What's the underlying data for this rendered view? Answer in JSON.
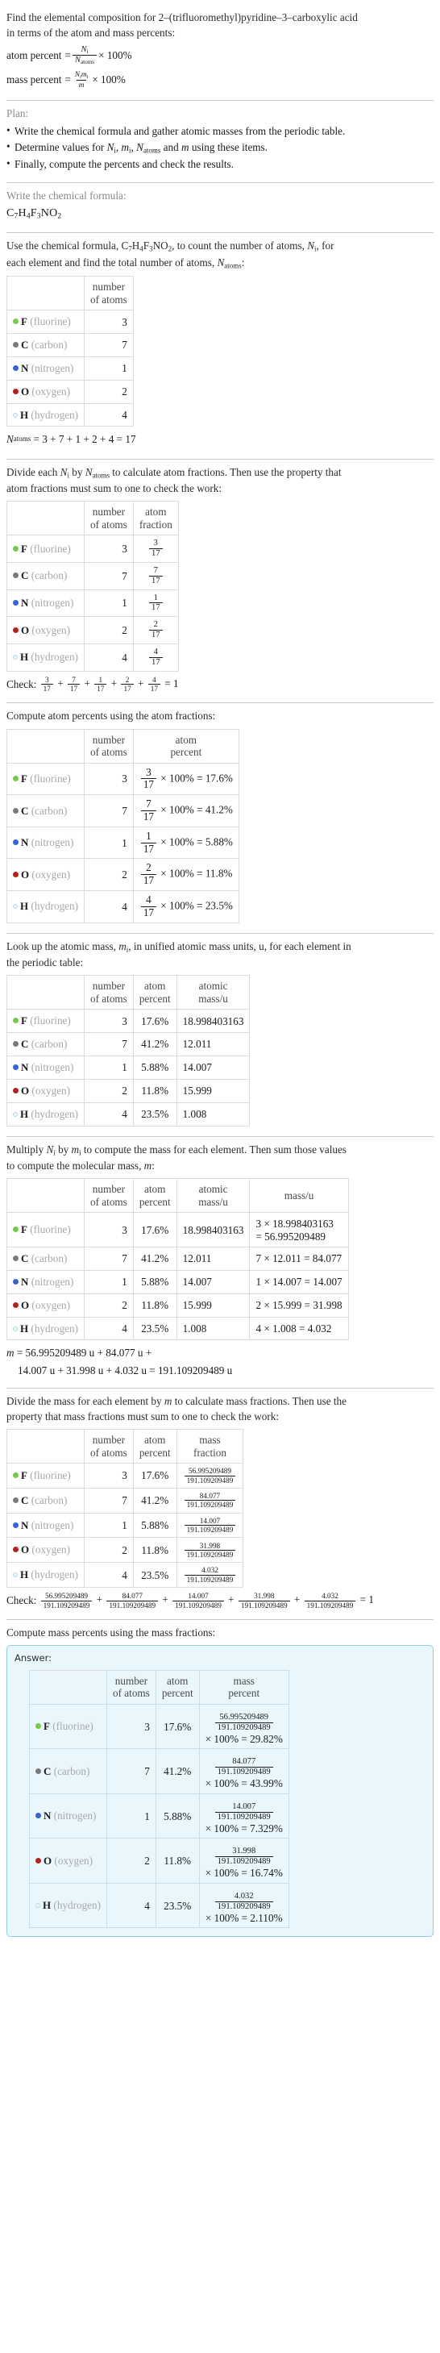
{
  "colors": {
    "fluorine": "#78c850",
    "carbon": "#7a7a7a",
    "nitrogen": "#3a63cf",
    "oxygen": "#b22222",
    "hydrogen_fill": "#ecf7fb",
    "hydrogen_stroke": "#b6d7e0",
    "answer_bg": "#e9f7fd",
    "answer_border": "#8fcfe6",
    "rule": "#c9c9c9",
    "table_border": "#dcdcdc"
  },
  "intro": {
    "line1": "Find the elemental composition for 2–(trifluoromethyl)pyridine–3–carboxylic acid",
    "line2": "in terms of the atom and mass percents:",
    "atom_percent_label": "atom percent",
    "mass_percent_label": "mass percent",
    "equals": "=",
    "times100": "× 100%",
    "Ni": "N",
    "Ni_sub": "i",
    "Natoms": "N",
    "Natoms_sub": "atoms",
    "mi": "m",
    "mi_sub": "i",
    "m": "m"
  },
  "plan": {
    "title": "Plan:",
    "items": [
      "Write the chemical formula and gather atomic masses from the periodic table.",
      "Determine values for Ni, mi, Natoms and m using these items.",
      "Finally, compute the percents and check the results."
    ],
    "item2_parts": {
      "before": "Determine values for ",
      "mid1": ", ",
      "mid2": ", ",
      "mid3": " and ",
      "after": " using these items."
    }
  },
  "formula_section": {
    "prompt": "Write the chemical formula:",
    "formula_parts": [
      {
        "sym": "C",
        "sub": "7"
      },
      {
        "sym": "H",
        "sub": "4"
      },
      {
        "sym": "F",
        "sub": "3"
      },
      {
        "sym": "N",
        "sub": ""
      },
      {
        "sym": "O",
        "sub": "2"
      }
    ],
    "formula_plain": "C7H4F3NO2"
  },
  "count_section": {
    "prompt_a": "Use the chemical formula, ",
    "prompt_b": ", to count the number of atoms, ",
    "prompt_c": ", for",
    "prompt_d": "each element and find the total number of atoms, ",
    "prompt_e": ":",
    "headers": [
      "",
      "number of atoms"
    ],
    "total_line": "= 3 + 7 + 1 + 2 + 4 = 17"
  },
  "fraction_section": {
    "prompt_a": "Divide each ",
    "prompt_b": " by ",
    "prompt_c": " to calculate atom fractions. Then use the property that",
    "prompt_d": "atom fractions must sum to one to check the work:",
    "headers": [
      "",
      "number of atoms",
      "atom fraction"
    ],
    "check_label": "Check:",
    "check_result": "= 1"
  },
  "atompercent_section": {
    "prompt": "Compute atom percents using the atom fractions:",
    "headers": [
      "",
      "number of atoms",
      "atom percent"
    ]
  },
  "atomicmass_section": {
    "prompt_a": "Look up the atomic mass, ",
    "prompt_b": ", in unified atomic mass units, u, for each element in",
    "prompt_c": "the periodic table:",
    "headers": [
      "",
      "number of atoms",
      "atom percent",
      "atomic mass/u"
    ]
  },
  "masscalc_section": {
    "prompt_a": "Multiply ",
    "prompt_b": " by ",
    "prompt_c": " to compute the mass for each element. Then sum those values",
    "prompt_d": "to compute the molecular mass, ",
    "prompt_e": ":",
    "headers": [
      "",
      "number of atoms",
      "atom percent",
      "atomic mass/u",
      "mass/u"
    ],
    "molar_line1": "= 56.995209489 u + 84.077 u +",
    "molar_line2": "14.007 u + 31.998 u + 4.032 u = 191.109209489 u"
  },
  "massfraction_section": {
    "prompt_a": "Divide the mass for each element by ",
    "prompt_b": " to calculate mass fractions. Then use the",
    "prompt_c": "property that mass fractions must sum to one to check the work:",
    "headers": [
      "",
      "number of atoms",
      "atom percent",
      "mass fraction"
    ],
    "check_label": "Check:",
    "check_result": "= 1"
  },
  "masspercent_section": {
    "prompt": "Compute mass percents using the mass fractions:",
    "answer_label": "Answer:",
    "headers": [
      "",
      "number of atoms",
      "atom percent",
      "mass percent"
    ],
    "times100": "× 100%"
  },
  "total_atoms": "17",
  "molecular_mass": "191.109209489",
  "elements": [
    {
      "symbol": "F",
      "name": "(fluorine)",
      "dot": "fluorine",
      "count": "3",
      "frac_num": "3",
      "frac_den": "17",
      "atom_percent": "17.6%",
      "atomic_mass": "18.998403163",
      "mass_calc": "3 × 18.998403163",
      "mass_calc_result": "= 56.995209489",
      "mass_calc_oneline": "",
      "mass": "56.995209489",
      "mass_percent": "29.82%"
    },
    {
      "symbol": "C",
      "name": "(carbon)",
      "dot": "carbon",
      "count": "7",
      "frac_num": "7",
      "frac_den": "17",
      "atom_percent": "41.2%",
      "atomic_mass": "12.011",
      "mass_calc": "",
      "mass_calc_result": "",
      "mass_calc_oneline": "7 × 12.011 = 84.077",
      "mass": "84.077",
      "mass_percent": "43.99%"
    },
    {
      "symbol": "N",
      "name": "(nitrogen)",
      "dot": "nitrogen",
      "count": "1",
      "frac_num": "1",
      "frac_den": "17",
      "atom_percent": "5.88%",
      "atomic_mass": "14.007",
      "mass_calc": "",
      "mass_calc_result": "",
      "mass_calc_oneline": "1 × 14.007 = 14.007",
      "mass": "14.007",
      "mass_percent": "7.329%"
    },
    {
      "symbol": "O",
      "name": "(oxygen)",
      "dot": "oxygen",
      "count": "2",
      "frac_num": "2",
      "frac_den": "17",
      "atom_percent": "11.8%",
      "atomic_mass": "15.999",
      "mass_calc": "",
      "mass_calc_result": "",
      "mass_calc_oneline": "2 × 15.999 = 31.998",
      "mass": "31.998",
      "mass_percent": "16.74%"
    },
    {
      "symbol": "H",
      "name": "(hydrogen)",
      "dot": "hydrogen",
      "count": "4",
      "frac_num": "4",
      "frac_den": "17",
      "atom_percent": "23.5%",
      "atomic_mass": "1.008",
      "mass_calc": "",
      "mass_calc_result": "",
      "mass_calc_oneline": "4 × 1.008 = 4.032",
      "mass": "4.032",
      "mass_percent": "2.110%"
    }
  ]
}
